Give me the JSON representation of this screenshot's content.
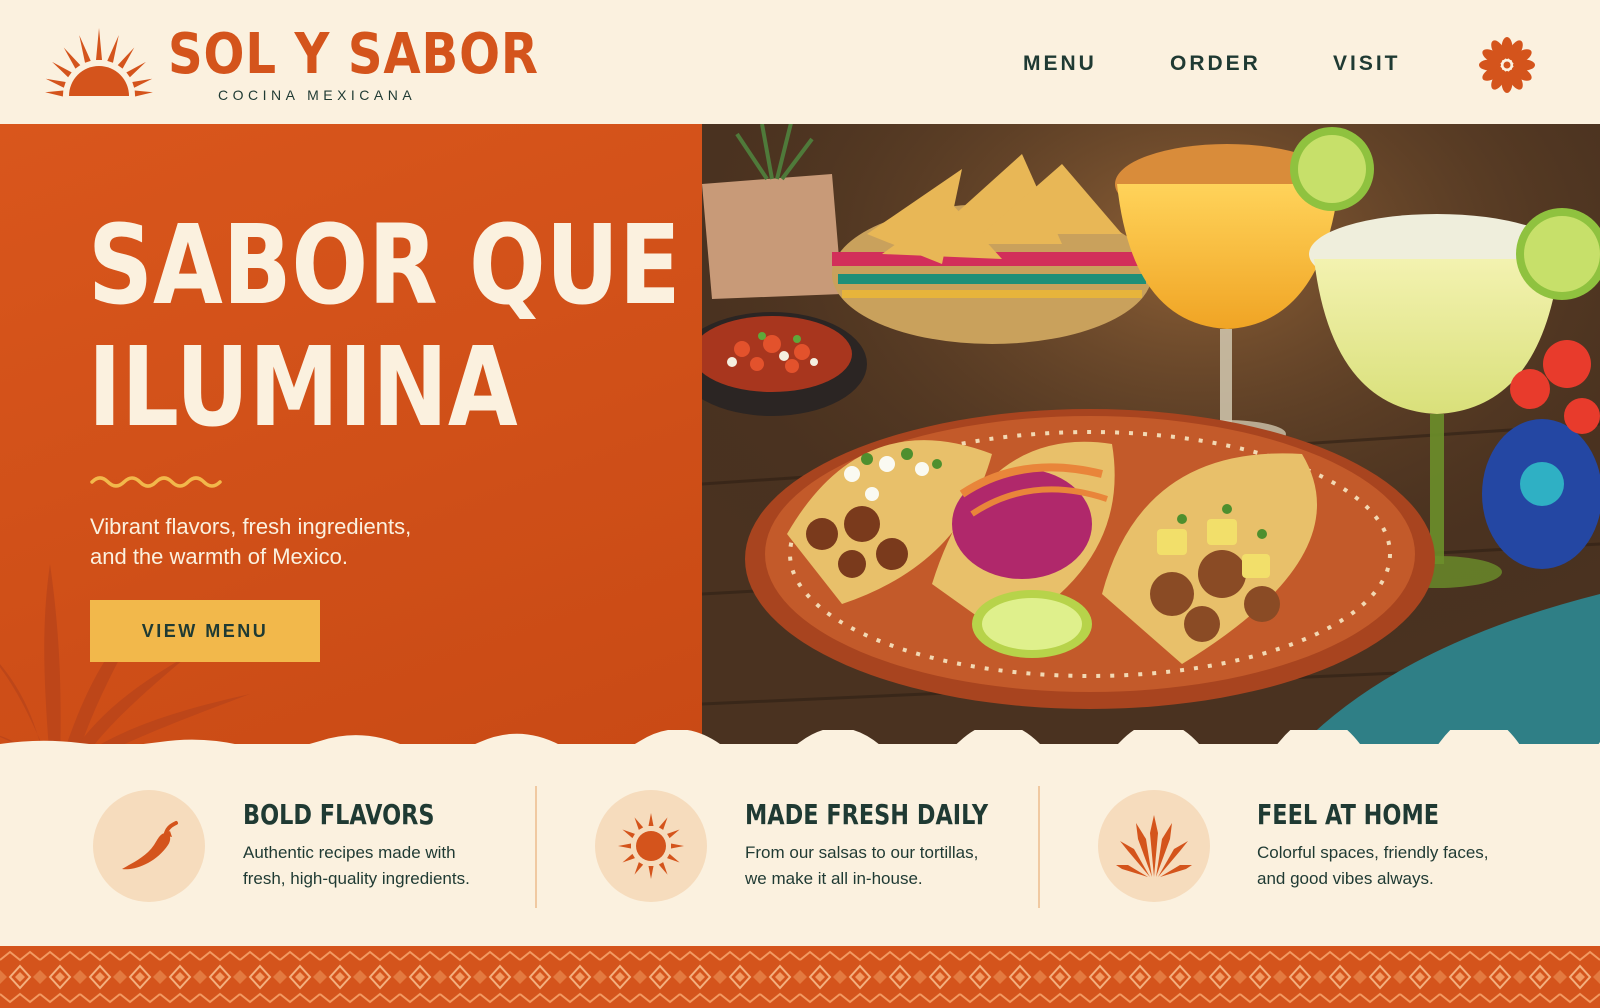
{
  "header": {
    "brand": "SOL Y SABOR",
    "tagline": "COCINA MEXICANA",
    "logo_icon": "sun-icon",
    "nav": [
      {
        "label": "MENU"
      },
      {
        "label": "ORDER"
      },
      {
        "label": "VISIT"
      }
    ],
    "flower_icon": "flower-icon"
  },
  "hero": {
    "title_line1": "SABOR QUE",
    "title_line2": "ILUMINA",
    "subtitle_line1": "Vibrant flavors, fresh ingredients,",
    "subtitle_line2": "and the warmth of Mexico.",
    "cta_label": "VIEW MENU",
    "image_subject": "tacos-and-margaritas-photo"
  },
  "features": [
    {
      "icon": "chili-pepper-icon",
      "title": "BOLD FLAVORS",
      "text_line1": "Authentic recipes made with",
      "text_line2": "fresh, high-quality ingredients."
    },
    {
      "icon": "sun-icon",
      "title": "MADE FRESH DAILY",
      "text_line1": "From our salsas to our tortillas,",
      "text_line2": "we make it all in-house."
    },
    {
      "icon": "agave-icon",
      "title": "FEEL AT HOME",
      "text_line1": "Colorful spaces, friendly faces,",
      "text_line2": "and good vibes always."
    }
  ],
  "colors": {
    "brand_orange": "#d4541c",
    "cream": "#fbf1df",
    "dark_green": "#1f3a33",
    "cta_yellow": "#f2b84b",
    "icon_circle": "#f6dcbd"
  }
}
